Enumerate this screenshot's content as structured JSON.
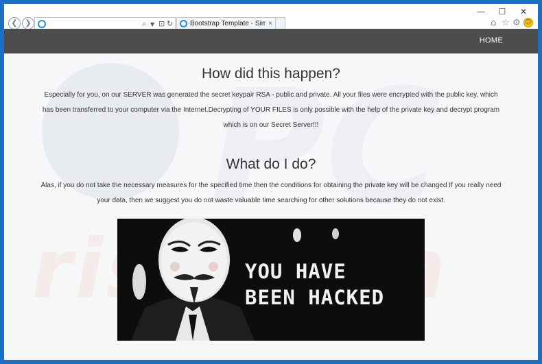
{
  "browser": {
    "tab_title": "Bootstrap Template - Simpla ...",
    "tab_close": "×",
    "window_controls": {
      "minimize": "—",
      "maximize": "☐",
      "close": "✕"
    },
    "icons": [
      "back-icon",
      "forward-icon",
      "ie-icon",
      "search-icon",
      "dropdown-icon",
      "lock-icon",
      "refresh-icon",
      "home-icon",
      "favorites-icon",
      "settings-icon",
      "smiley-icon"
    ]
  },
  "nav": {
    "home": "HOME"
  },
  "section1": {
    "heading": "How did this happen?",
    "body": "Especially for you, on our SERVER was generated the secret keypair RSA - public and private. All your files were encrypted with the public key, which has been transferred to your computer via the Internet.Decrypting of YOUR FILES is only possible with the help of the private key and decrypt program which is on our Secret Server!!!"
  },
  "section2": {
    "heading": "What do I do?",
    "body": "Alas, if you do not take the necessary measures for the specified time then the conditions for obtaining the private key will be changed If you really need your data, then we suggest you do not waste valuable time searching for other solutions because they do not exist."
  },
  "hero": {
    "line1": "YOU HAVE",
    "line2": "BEEN HACKED"
  },
  "watermark": "risk.com",
  "colors": {
    "frame": "#1c6fc3",
    "navbar": "#4d4d4d",
    "page_bg": "#f6f7f9"
  }
}
